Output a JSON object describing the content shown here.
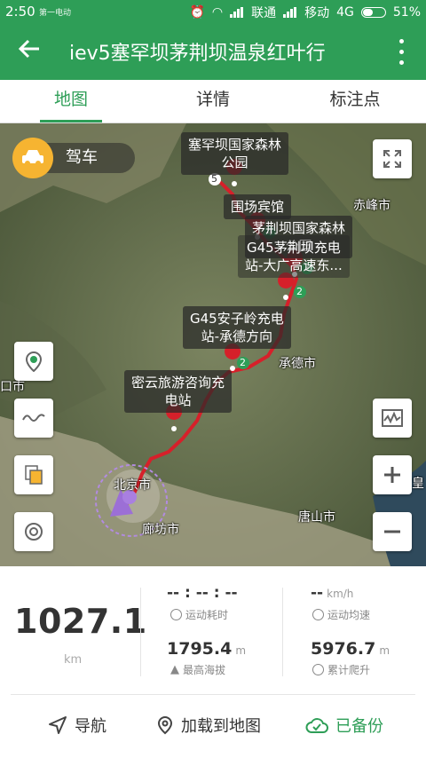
{
  "status_bar": {
    "time": "2:50",
    "carrier_small": "第一电动",
    "carrier1": "联通",
    "carrier2": "移动",
    "network": "4G",
    "battery": "51%",
    "battery_level": 0.51
  },
  "app_bar": {
    "back_icon": "arrow-left-icon",
    "title": "iev5塞罕坝茅荆坝温泉红叶行",
    "more_icon": "more-vertical-icon"
  },
  "tabs": [
    {
      "label": "地图"
    },
    {
      "label": "详情"
    },
    {
      "label": "标注点"
    }
  ],
  "map": {
    "mode_label": "驾车",
    "labels": {
      "saihanba": "塞罕坝国家森林\n公园",
      "weichang": "围场宾馆",
      "maojingba": "茅荆坝国家森林\n公园",
      "g45_dagang": "G45茅荆坝充电\n站-大广高速东...",
      "g45_anziling": "G45安子岭充电\n站-承德方向",
      "miyun": "密云旅游咨询充\n电站"
    },
    "cities": {
      "chifeng": "赤峰市",
      "chengde": "承德市",
      "beijing": "北京市",
      "tangshan": "唐山市",
      "langfang": "廊坊市",
      "left_edge": "口市",
      "right_edge": "皇"
    },
    "marker_badges": [
      "5",
      "4",
      "2",
      "2",
      "2"
    ]
  },
  "stats": {
    "distance": "1027.1",
    "distance_unit": "km",
    "duration": "-- : -- : --",
    "duration_label": "运动耗时",
    "speed": "--",
    "speed_unit": "km/h",
    "speed_label": "运动均速",
    "altitude": "1795.4",
    "altitude_unit": "m",
    "altitude_label": "最高海拔",
    "climb": "5976.7",
    "climb_unit": "m",
    "climb_label": "累计爬升"
  },
  "actions": {
    "navigate": "导航",
    "load_to_map": "加载到地图",
    "backed_up": "已备份"
  }
}
